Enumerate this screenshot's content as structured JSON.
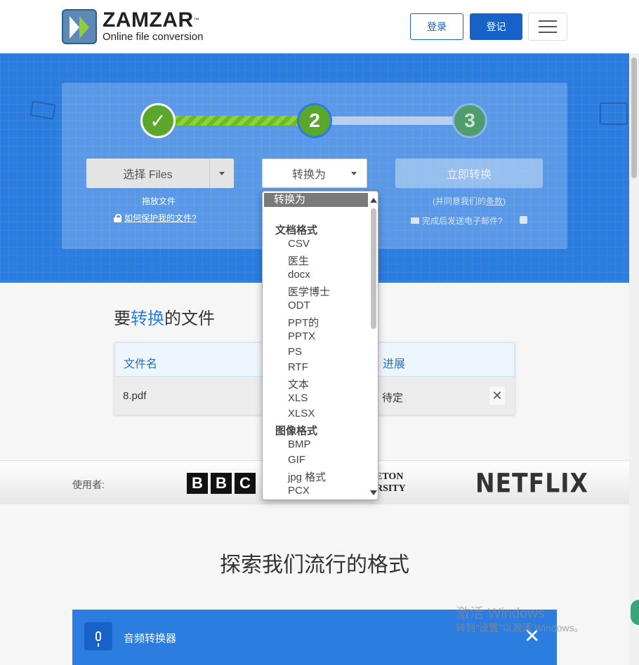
{
  "header": {
    "logo_name": "ZAMZAR",
    "logo_tm": "™",
    "logo_tagline": "Online file conversion",
    "login_label": "登录",
    "signup_label": "登记"
  },
  "steps": {
    "step1": "✓",
    "step2": "2",
    "step3": "3"
  },
  "upload": {
    "choose_label": "选择 Files",
    "drop_hint": "拖放文件",
    "protect_link": "如何保护我的文件?"
  },
  "convert_select": {
    "selected": "转换为"
  },
  "convert_now": {
    "label": "立即转换",
    "agree_prefix": "(并同意我们的",
    "agree_link": "条款",
    "agree_suffix": ")",
    "email_label": "完成后发送电子邮件?"
  },
  "files": {
    "title_prefix": "要",
    "title_highlight": "转换",
    "title_suffix": "的文件",
    "col_name": "文件名",
    "col_progress": "进展",
    "rows": [
      {
        "name": "8.pdf",
        "status": "待定",
        "remove": "✕"
      }
    ]
  },
  "usedby": {
    "label": "使用者:",
    "bbc": [
      "B",
      "B",
      "C"
    ],
    "princeton_line1": "ETON",
    "princeton_line2": "RSITY",
    "netflix": "NETFLIX"
  },
  "explore_title": "探索我们流行的格式",
  "audio_bar": {
    "label": "音频转换器",
    "close": "✕"
  },
  "watermark": {
    "line1": "激活 Windows",
    "line2": "转到\"设置\"以激活 Windows。"
  },
  "dropdown": {
    "selected": "转换为",
    "groups": [
      {
        "label": "文档格式",
        "options": [
          "CSV",
          "医生",
          "docx",
          "医学博士",
          "ODT",
          "PPT的",
          "PPTX",
          "PS",
          "RTF",
          "文本",
          "XLS",
          "XLSX"
        ]
      },
      {
        "label": "图像格式",
        "options": [
          "BMP",
          "GIF",
          "jpg 格式",
          "PCX"
        ]
      }
    ]
  },
  "colors": {
    "brand_blue": "#2b7de0",
    "button_blue": "#1762c9",
    "step_green": "#5aa72b"
  }
}
